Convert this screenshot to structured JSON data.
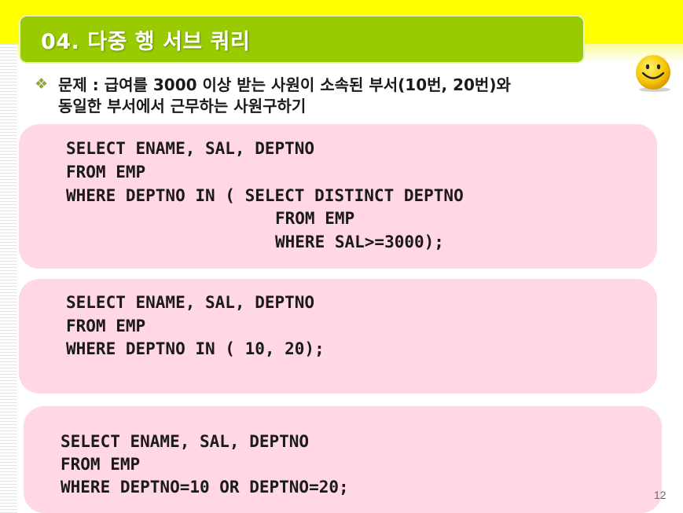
{
  "slide": {
    "title": "04. 다중 행 서브 쿼리",
    "page_number": "12"
  },
  "question": {
    "icon": "diamond-bullet-icon",
    "line1": "문제  : 급여를 3000 이상 받는 사원이 소속된 부서(10번, 20번)와",
    "line2": "동일한 부서에서 근무하는 사원구하기"
  },
  "boxes": [
    {
      "lines": [
        "SELECT ENAME, SAL, DEPTNO",
        "FROM EMP",
        "WHERE DEPTNO IN ( SELECT DISTINCT DEPTNO",
        "FROM EMP",
        "WHERE SAL>=3000);"
      ]
    },
    {
      "lines": [
        "SELECT ENAME, SAL, DEPTNO",
        "FROM EMP",
        "WHERE DEPTNO IN ( 10, 20);"
      ]
    },
    {
      "lines": [
        "SELECT ENAME, SAL, DEPTNO",
        "FROM EMP",
        "WHERE DEPTNO=10 OR DEPTNO=20;"
      ]
    }
  ],
  "colors": {
    "top_band": "#ffff00",
    "title_banner": "#99cc00",
    "code_box": "#ffd7e6",
    "bullet": "#8fa83b"
  },
  "decoration": {
    "smiley": "smiley-face-icon"
  }
}
